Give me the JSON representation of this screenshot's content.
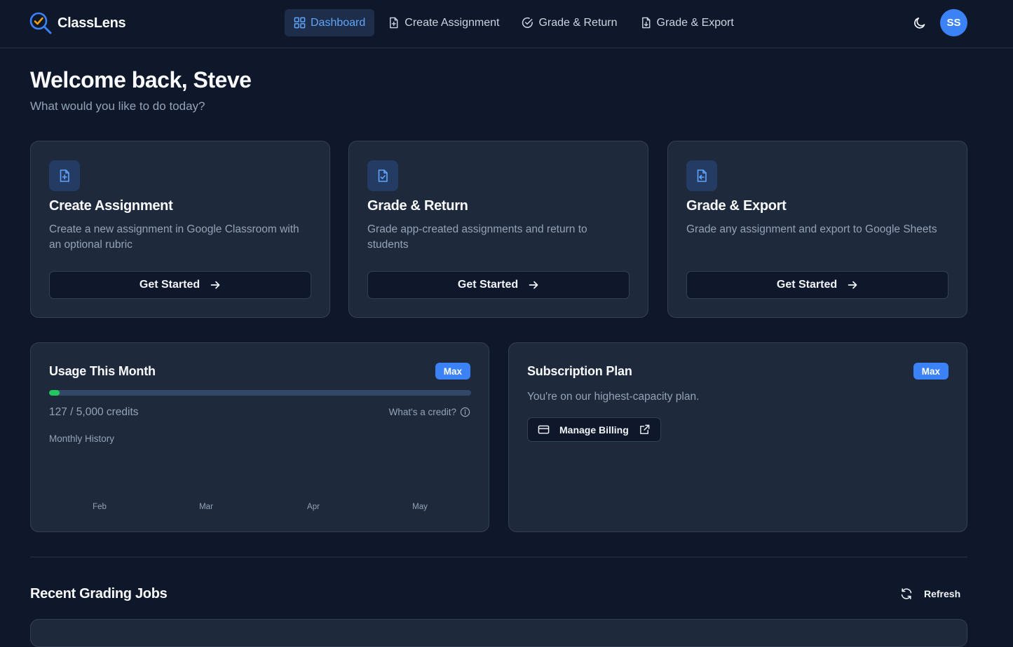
{
  "app": {
    "name": "ClassLens"
  },
  "nav": {
    "links": [
      {
        "label": "Dashboard",
        "icon": "grid-icon",
        "active": true
      },
      {
        "label": "Create Assignment",
        "icon": "file-plus-icon",
        "active": false
      },
      {
        "label": "Grade & Return",
        "icon": "check-circle-icon",
        "active": false
      },
      {
        "label": "Grade & Export",
        "icon": "file-export-icon",
        "active": false
      }
    ],
    "theme_icon": "moon-icon",
    "avatar_initials": "SS"
  },
  "header": {
    "welcome": "Welcome back, Steve",
    "subtitle": "What would you like to do today?"
  },
  "cards": [
    {
      "title": "Create Assignment",
      "description": "Create a new assignment in Google Classroom with an optional rubric",
      "button": "Get Started",
      "icon": "file-plus-icon"
    },
    {
      "title": "Grade & Return",
      "description": "Grade app-created assignments and return to students",
      "button": "Get Started",
      "icon": "file-check-icon"
    },
    {
      "title": "Grade & Export",
      "description": "Grade any assignment and export to Google Sheets",
      "button": "Get Started",
      "icon": "file-export-icon"
    }
  ],
  "usage": {
    "title": "Usage This Month",
    "badge": "Max",
    "used": 127,
    "limit": 5000,
    "credits_text": "127 / 5,000 credits",
    "help_text": "What's a credit?",
    "history_label": "Monthly History",
    "months": [
      "Feb",
      "Mar",
      "Apr",
      "May"
    ]
  },
  "subscription": {
    "title": "Subscription Plan",
    "badge": "Max",
    "description": "You're on our highest-capacity plan.",
    "billing_button": "Manage Billing"
  },
  "recent": {
    "title": "Recent Grading Jobs",
    "refresh_label": "Refresh"
  },
  "colors": {
    "background": "#0f172a",
    "card": "#1e293b",
    "accent": "#3b82f6",
    "progress": "#22c55e"
  }
}
